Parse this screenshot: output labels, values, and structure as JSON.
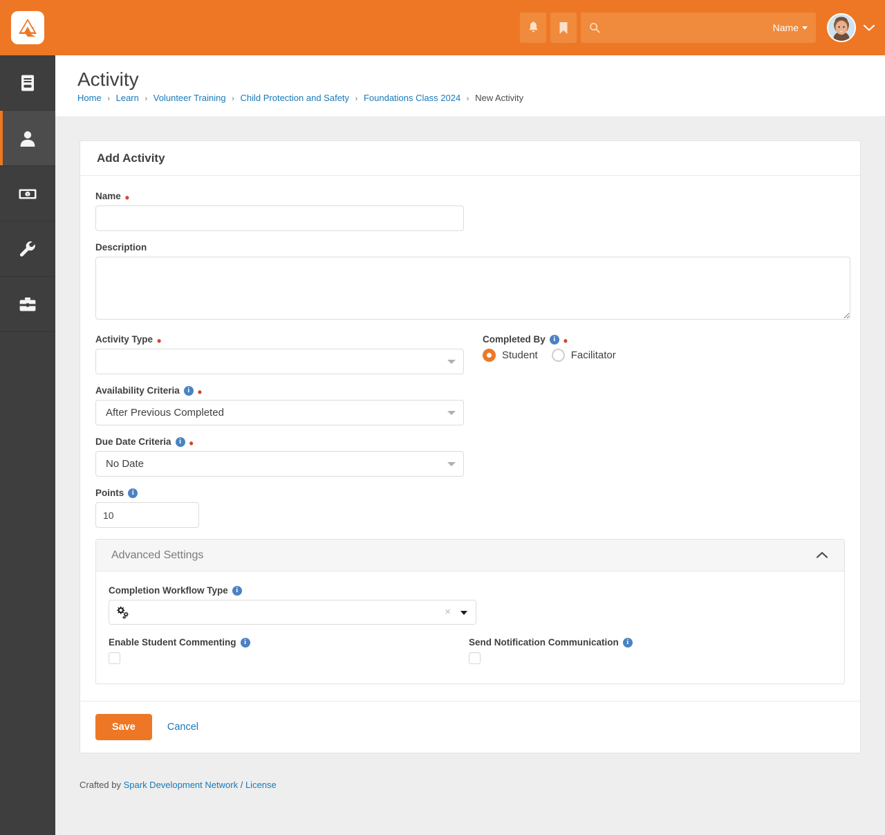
{
  "header": {
    "logo_name": "rock-logo",
    "notifications_icon": "bell-icon",
    "bookmarks_icon": "bookmark-icon",
    "search": {
      "placeholder": "",
      "value": "",
      "scope_label": "Name"
    },
    "avatar_label": "user-avatar",
    "user_menu_icon": "chevron-down-icon"
  },
  "sidebar": {
    "items": [
      {
        "icon": "book-icon",
        "name": "cms",
        "active": false
      },
      {
        "icon": "person-icon",
        "name": "people",
        "active": true
      },
      {
        "icon": "money-icon",
        "name": "finance",
        "active": false
      },
      {
        "icon": "wrench-icon",
        "name": "admin-tools",
        "active": false
      },
      {
        "icon": "briefcase-icon",
        "name": "tools",
        "active": false
      }
    ]
  },
  "page": {
    "title": "Activity",
    "breadcrumb": [
      {
        "label": "Home",
        "link": true
      },
      {
        "label": "Learn",
        "link": true
      },
      {
        "label": "Volunteer Training",
        "link": true
      },
      {
        "label": "Child Protection and Safety",
        "link": true
      },
      {
        "label": "Foundations Class 2024",
        "link": true
      },
      {
        "label": "New Activity",
        "link": false
      }
    ],
    "breadcrumb_separator": "›"
  },
  "panel": {
    "title": "Add Activity",
    "fields": {
      "name": {
        "label": "Name",
        "required": true,
        "value": "",
        "placeholder": ""
      },
      "description": {
        "label": "Description",
        "required": false,
        "value": "",
        "placeholder": ""
      },
      "activity_type": {
        "label": "Activity Type",
        "required": true,
        "value": "",
        "placeholder": ""
      },
      "completed_by": {
        "label": "Completed By",
        "required": true,
        "has_info": true,
        "options": [
          {
            "label": "Student",
            "selected": true
          },
          {
            "label": "Facilitator",
            "selected": false
          }
        ]
      },
      "availability_criteria": {
        "label": "Availability Criteria",
        "required": true,
        "has_info": true,
        "value": "After Previous Completed"
      },
      "due_date_criteria": {
        "label": "Due Date Criteria",
        "required": true,
        "has_info": true,
        "value": "No Date"
      },
      "points": {
        "label": "Points",
        "required": false,
        "has_info": true,
        "value": "10"
      }
    },
    "advanced": {
      "title": "Advanced Settings",
      "toggle_icon": "chevron-up-icon",
      "completion_workflow_type": {
        "label": "Completion Workflow Type",
        "has_info": true,
        "value": "",
        "icon": "cogs-icon",
        "clear_icon": "clear-x-icon",
        "dropdown_icon": "caret-down-icon"
      },
      "enable_student_commenting": {
        "label": "Enable Student Commenting",
        "has_info": true,
        "checked": false
      },
      "send_notification_communication": {
        "label": "Send Notification Communication",
        "has_info": true,
        "checked": false
      }
    },
    "actions": {
      "save_label": "Save",
      "cancel_label": "Cancel"
    }
  },
  "footer": {
    "crafted_by": "Crafted by",
    "org": "Spark Development Network",
    "divider": "/",
    "license": "License"
  },
  "colors": {
    "brand_orange": "#ee7725",
    "link_blue": "#1779ba",
    "sidebar_dark": "#3e3e3e",
    "required_red": "#d4442e",
    "info_blue": "#4b82c3"
  }
}
